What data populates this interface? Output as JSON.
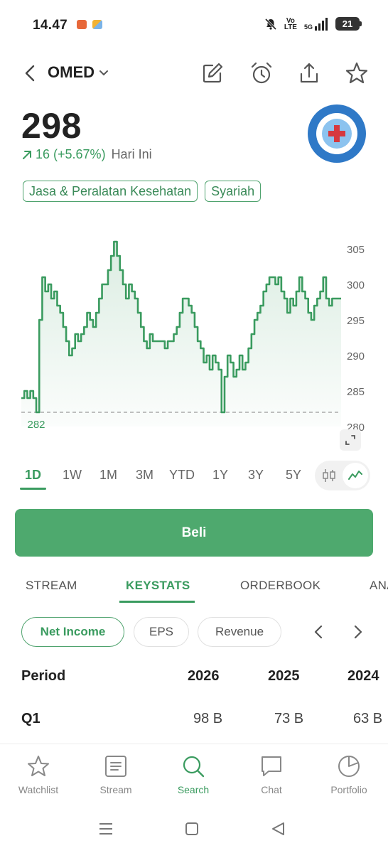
{
  "status_bar": {
    "time": "14.47",
    "volte_top": "Vo",
    "volte_bottom": "LTE",
    "network": "5G",
    "battery": "21"
  },
  "header": {
    "ticker": "OMED"
  },
  "quote": {
    "price": "298",
    "change": "16 (+5.67%)",
    "change_period": "Hari Ini",
    "tags": [
      "Jasa & Peralatan Kesehatan",
      "Syariah"
    ]
  },
  "chart_data": {
    "type": "line",
    "y_ticks": [
      "305",
      "300",
      "295",
      "290",
      "285",
      "280"
    ],
    "ylim": [
      280,
      307
    ],
    "high_label": "306",
    "low_label": "282",
    "baseline": 282,
    "values": [
      284,
      285,
      284,
      285,
      284,
      282,
      295,
      301,
      299,
      300,
      298,
      299,
      297,
      296,
      294,
      292,
      290,
      291,
      293,
      292,
      293,
      294,
      296,
      295,
      294,
      296,
      298,
      300,
      300,
      302,
      304,
      306,
      304,
      302,
      300,
      298,
      300,
      299,
      298,
      296,
      294,
      292,
      291,
      293,
      292,
      292,
      292,
      292,
      291,
      292,
      292,
      293,
      294,
      296,
      298,
      298,
      297,
      296,
      294,
      292,
      291,
      289,
      290,
      288,
      290,
      289,
      288,
      282,
      287,
      290,
      289,
      287,
      288,
      290,
      288,
      289,
      291,
      293,
      295,
      296,
      297,
      299,
      300,
      301,
      301,
      300,
      301,
      299,
      298,
      296,
      298,
      297,
      299,
      301,
      299,
      298,
      296,
      295,
      297,
      298,
      299,
      301,
      298,
      297,
      298,
      298,
      298,
      298
    ],
    "ranges": [
      "1D",
      "1W",
      "1M",
      "3M",
      "YTD",
      "1Y",
      "3Y",
      "5Y"
    ],
    "active_range": "1D",
    "line_color": "#3a9b5f"
  },
  "buy_button": "Beli",
  "tabs": [
    "STREAM",
    "KEYSTATS",
    "ORDERBOOK",
    "ANALYSIS"
  ],
  "active_tab": "KEYSTATS",
  "pills": [
    "Net Income",
    "EPS",
    "Revenue"
  ],
  "active_pill": "Net Income",
  "keystats_table": {
    "headers": [
      "Period",
      "2026",
      "2025",
      "2024"
    ],
    "rows": [
      [
        "Q1",
        "98 B",
        "73 B",
        "63 B"
      ]
    ]
  },
  "bottom_nav": [
    {
      "label": "Watchlist",
      "icon": "star-icon"
    },
    {
      "label": "Stream",
      "icon": "stream-icon"
    },
    {
      "label": "Search",
      "icon": "search-icon"
    },
    {
      "label": "Chat",
      "icon": "chat-icon"
    },
    {
      "label": "Portfolio",
      "icon": "portfolio-icon"
    }
  ],
  "active_nav": "Search",
  "colors": {
    "accent": "#3a9b5f",
    "buy": "#4ea96e",
    "logo_ring": "#2f79c7",
    "logo_cross": "#d6393f"
  }
}
